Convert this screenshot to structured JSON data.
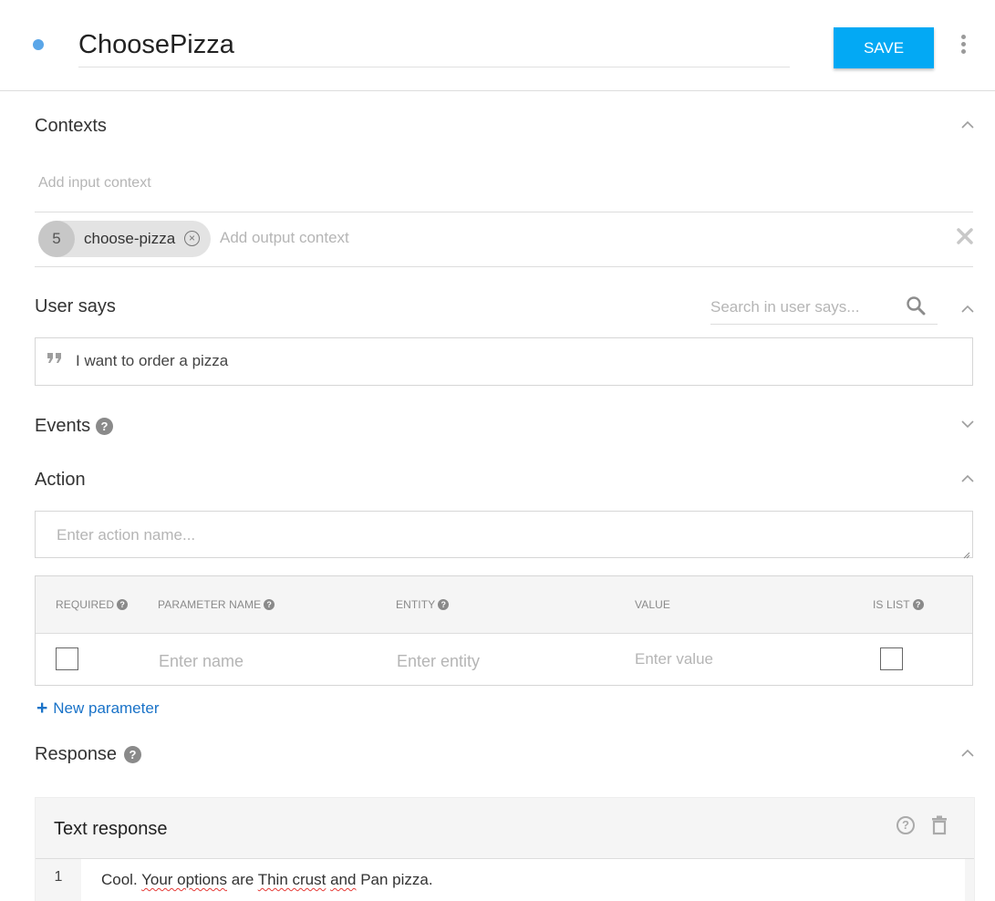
{
  "header": {
    "intent_name": "ChoosePizza",
    "save_label": "SAVE",
    "status_color": "#5aa6e8",
    "accent_color": "#03a9f4"
  },
  "contexts": {
    "title": "Contexts",
    "input_placeholder": "Add input context",
    "output_contexts": [
      {
        "lifespan": "5",
        "name": "choose-pizza"
      }
    ],
    "output_placeholder": "Add output context"
  },
  "user_says": {
    "title": "User says",
    "search_placeholder": "Search in user says...",
    "phrases": [
      "I want to order a pizza"
    ]
  },
  "events": {
    "title": "Events"
  },
  "action": {
    "title": "Action",
    "placeholder": "Enter action name...",
    "table": {
      "headers": {
        "required": "REQUIRED",
        "parameter_name": "PARAMETER NAME",
        "entity": "ENTITY",
        "value": "VALUE",
        "is_list": "IS LIST"
      },
      "row": {
        "name_placeholder": "Enter name",
        "entity_placeholder": "Enter entity",
        "value_placeholder": "Enter value"
      }
    },
    "new_parameter_label": "New parameter"
  },
  "response": {
    "title": "Response",
    "text_response_title": "Text response",
    "rows": [
      {
        "index": "1",
        "parts": [
          "Cool. ",
          "Your options",
          " are ",
          "Thin crust",
          " ",
          "and",
          " Pan pizza."
        ]
      }
    ]
  },
  "icons": {
    "status": "status-dot-icon",
    "more": "more-vertical-icon",
    "chevron_up": "chevron-up-icon",
    "chevron_down": "chevron-down-icon",
    "remove_chip": "close-circle-icon",
    "clear": "close-icon",
    "search": "search-icon",
    "quote": "quote-icon",
    "help": "help-icon",
    "add": "plus-icon",
    "delete": "trash-icon"
  }
}
